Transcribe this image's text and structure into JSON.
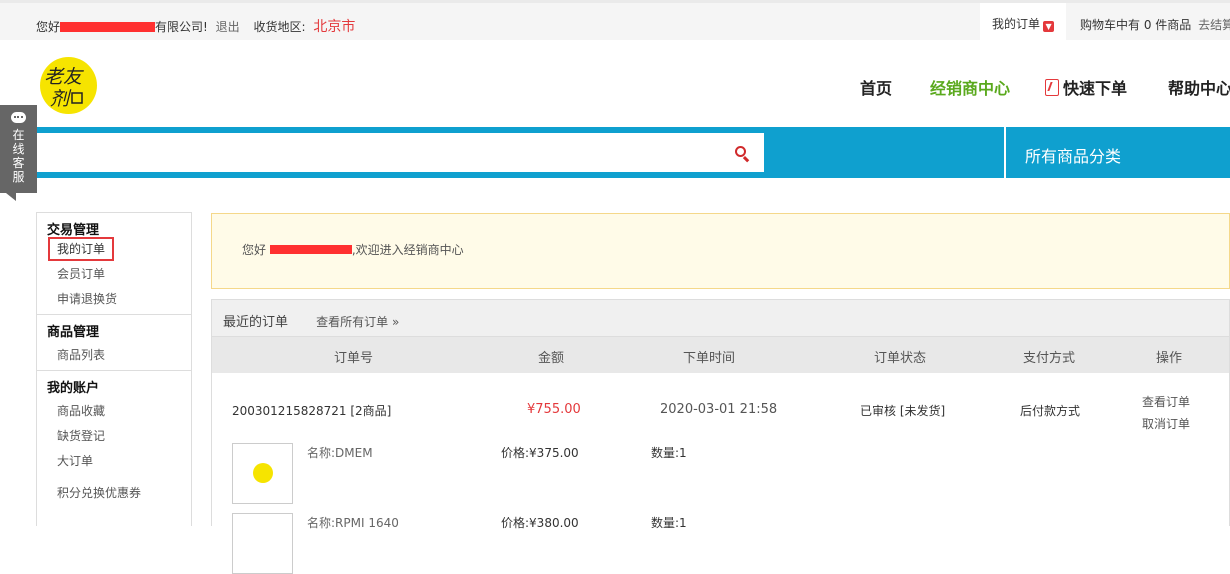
{
  "topbar": {
    "greeting_prefix": "您好",
    "greeting_suffix": "有限公司!",
    "logout": "退出",
    "region_label": "收货地区:",
    "region": "北京市",
    "my_orders": "我的订单",
    "cart_text": "购物车中有 0 件商品",
    "checkout": "去结算"
  },
  "header": {
    "logo_text": "老友剂",
    "nav": [
      "首页",
      "经销商中心",
      "快速下单",
      "帮助中心"
    ],
    "search_placeholder": "",
    "all_categories": "所有商品分类"
  },
  "online_service": [
    "在",
    "线",
    "客",
    "服"
  ],
  "sidebar": [
    {
      "title": "交易管理",
      "items": [
        "我的订单",
        "会员订单",
        "申请退换货"
      ]
    },
    {
      "title": "商品管理",
      "items": [
        "商品列表"
      ]
    },
    {
      "title": "我的账户",
      "items": [
        "商品收藏",
        "缺货登记",
        "大订单",
        "积分兑换优惠券"
      ]
    }
  ],
  "welcome": {
    "prefix": "您好",
    "suffix": ",欢迎进入经销商中心"
  },
  "orders": {
    "title": "最近的订单",
    "view_all": "查看所有订单 »",
    "columns": [
      "订单号",
      "金额",
      "下单时间",
      "订单状态",
      "支付方式",
      "操作"
    ],
    "order": {
      "number": "200301215828721 [2商品]",
      "amount": "¥755.00",
      "time": "2020-03-01 21:58",
      "status": "已审核 [未发货]",
      "payment": "后付款方式",
      "actions": [
        "查看订单",
        "取消订单"
      ]
    },
    "items": [
      {
        "name": "名称:DMEM",
        "price": "价格:¥375.00",
        "qty": "数量:1"
      },
      {
        "name": "名称:RPMI 1640",
        "price": "价格:¥380.00",
        "qty": "数量:1"
      }
    ]
  },
  "colors": {
    "accent_blue": "#0fa0cf",
    "brand_green": "#5aa91d",
    "red": "#e4393c",
    "logo_yellow": "#f6e400"
  }
}
